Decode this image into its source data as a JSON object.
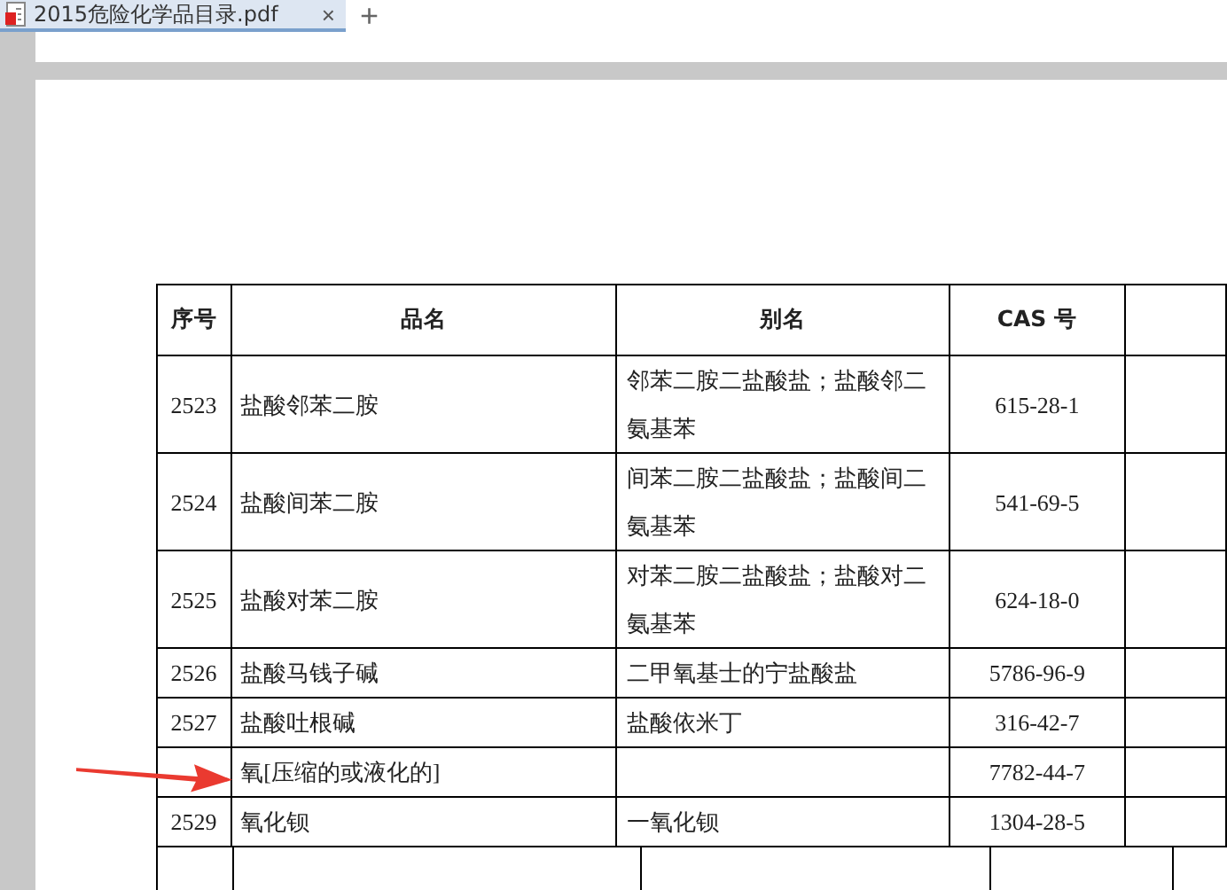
{
  "tabs": [
    {
      "label": "2015危险化学品目录.pdf",
      "selected": true,
      "close": "×"
    }
  ],
  "new_tab": "+",
  "table": {
    "columns": [
      "序号",
      "品名",
      "别名",
      "CAS 号"
    ],
    "rows": [
      {
        "number": "2523",
        "name": "盐酸邻苯二胺",
        "alias": "邻苯二胺二盐酸盐；盐酸邻二氨基苯",
        "cas": "615-28-1"
      },
      {
        "number": "2524",
        "name": "盐酸间苯二胺",
        "alias": "间苯二胺二盐酸盐；盐酸间二氨基苯",
        "cas": "541-69-5"
      },
      {
        "number": "2525",
        "name": "盐酸对苯二胺",
        "alias": "对苯二胺二盐酸盐；盐酸对二氨基苯",
        "cas": "624-18-0"
      },
      {
        "number": "2526",
        "name": "盐酸马钱子碱",
        "alias": "二甲氧基士的宁盐酸盐",
        "cas": "5786-96-9"
      },
      {
        "number": "2527",
        "name": "盐酸吐根碱",
        "alias": "盐酸依米丁",
        "cas": "316-42-7"
      },
      {
        "name": "氧[压缩的或液化的]",
        "cas": "7782-44-7",
        "marked": true
      },
      {
        "number": "2529",
        "name": "氧化钡",
        "alias": "一氧化钡",
        "cas": "1304-28-5"
      }
    ]
  }
}
